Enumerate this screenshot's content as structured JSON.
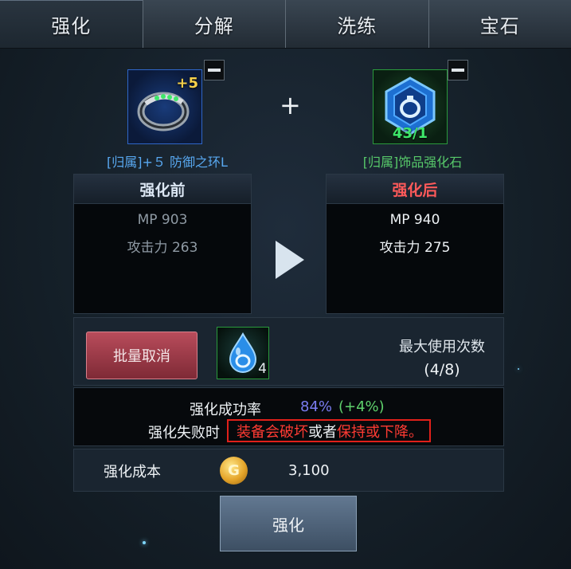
{
  "tabs": [
    {
      "label": "强化"
    },
    {
      "label": "分解"
    },
    {
      "label": "洗练"
    },
    {
      "label": "宝石"
    }
  ],
  "equipment": {
    "enhance_level": "+5",
    "name": "[归属]+５ 防御之环L",
    "icon": "ring-icon"
  },
  "material_stone": {
    "count": "43/1",
    "name": "[归属]饰品强化石",
    "icon": "enhance-stone-icon"
  },
  "plus_sign": "+",
  "before": {
    "title": "强化前",
    "stats": [
      "MP 903",
      "攻击力 263"
    ]
  },
  "after": {
    "title": "强化后",
    "stats": [
      "MP 940",
      "攻击力 275"
    ]
  },
  "batch_cancel_label": "批量取消",
  "potion": {
    "qty": "4",
    "icon": "blue-drop-potion-icon"
  },
  "max_use": {
    "label": "最大使用次数",
    "value": "(4/8)"
  },
  "success": {
    "label": "强化成功率",
    "rate": "84%",
    "bonus": "(+4%)"
  },
  "failure": {
    "label": "强化失败时",
    "part1": "装备会破坏",
    "part2": "或者",
    "part3": "保持或下降。"
  },
  "cost": {
    "label": "强化成本",
    "coin_icon": "gold-coin-icon",
    "value": "3,100"
  },
  "enhance_button_label": "强化",
  "colors": {
    "before_title": "#dbe6f3",
    "after_title": "#ff5a5a",
    "rate": "#7a7cf0",
    "bonus": "#5fd16c",
    "warning": "#ff3b33"
  }
}
